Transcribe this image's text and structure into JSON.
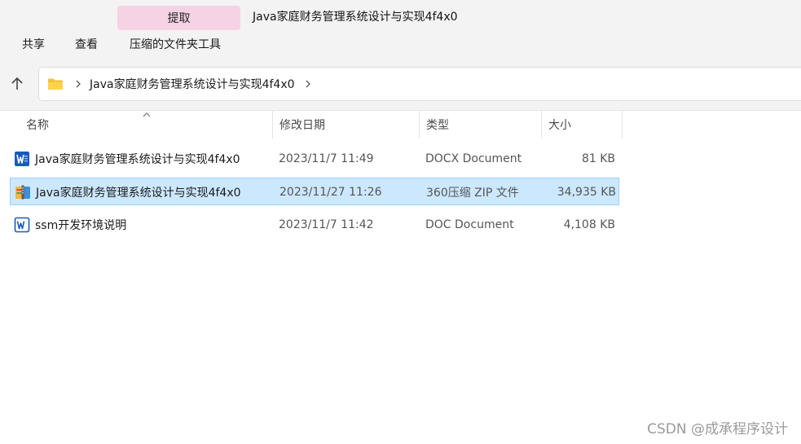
{
  "ribbon": {
    "context_tab": "提取",
    "window_title": "Java家庭财务管理系统设计与实现4f4x0",
    "tabs": [
      "共享",
      "查看",
      "压缩的文件夹工具"
    ]
  },
  "address_bar": {
    "breadcrumbs": [
      "Java家庭财务管理系统设计与实现4f4x0"
    ]
  },
  "columns": {
    "name": "名称",
    "date": "修改日期",
    "type": "类型",
    "size": "大小"
  },
  "files": [
    {
      "name": "Java家庭财务管理系统设计与实现4f4x0",
      "date": "2023/11/7 11:49",
      "type": "DOCX Document",
      "size": "81 KB",
      "icon": "word-docx-icon"
    },
    {
      "name": "Java家庭财务管理系统设计与实现4f4x0",
      "date": "2023/11/27 11:26",
      "type": "360压缩 ZIP 文件",
      "size": "34,935 KB",
      "icon": "zip-archive-icon",
      "selected": true
    },
    {
      "name": "ssm开发环境说明",
      "date": "2023/11/7 11:42",
      "type": "DOC Document",
      "size": "4,108 KB",
      "icon": "word-doc-icon"
    }
  ],
  "watermark": "CSDN @成承程序设计",
  "colors": {
    "selection_bg": "#cce8ff",
    "context_tab_bg": "#f5d3e4",
    "word_blue": "#185abd"
  }
}
